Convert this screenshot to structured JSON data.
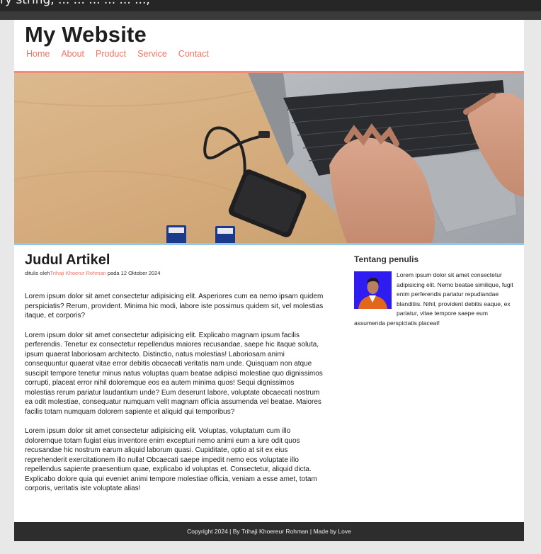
{
  "browser": {
    "top_text": "ry string, ... ... ... ... ... ...,"
  },
  "header": {
    "site_title": "My Website",
    "nav": [
      "Home",
      "About",
      "Product",
      "Service",
      "Contact"
    ]
  },
  "colors": {
    "accent": "#ef7565",
    "hero_border_top": "#f38a7c",
    "hero_border_bottom": "#8fc8ee",
    "footer_bg": "#2d2d2d"
  },
  "article": {
    "title": "Judul Artikel",
    "meta_prefix": "ditulis oleh",
    "author": "Trihaji Khoerur Rohman",
    "meta_suffix": " pada 12 Oktober 2024",
    "paragraphs": [
      "Lorem ipsum dolor sit amet consectetur adipisicing elit. Asperiores cum ea nemo ipsam quidem perspiciatis? Rerum, provident. Minima hic modi, labore iste possimus quidem sit, vel molestias itaque, et corporis?",
      "Lorem ipsum dolor sit amet consectetur adipisicing elit. Explicabo magnam ipsum facilis perferendis. Tenetur ex consectetur repellendus maiores recusandae, saepe hic itaque soluta, ipsum quaerat laboriosam architecto. Distinctio, natus molestias! Laboriosam animi consequuntur quaerat vitae error debitis obcaecati veritatis nam unde. Quisquam non atque suscipit tempore tenetur minus natus voluptas quam beatae adipisci molestiae quo dignissimos corrupti, placeat error nihil doloremque eos ea autem minima quos! Sequi dignissimos molestias rerum pariatur laudantium unde? Eum deserunt labore, voluptate obcaecati nostrum ea odit molestiae, consequatur numquam velit magnam officia assumenda vel beatae. Maiores facilis totam numquam dolorem sapiente et aliquid qui temporibus?",
      "Lorem ipsum dolor sit amet consectetur adipisicing elit. Voluptas, voluptatum cum illo doloremque totam fugiat eius inventore enim excepturi nemo animi eum a iure odit quos recusandae hic nostrum earum aliquid laborum quasi. Cupiditate, optio at sit ex eius reprehenderit exercitationem illo nulla! Obcaecati saepe impedit nemo eos voluptate illo repellendus sapiente praesentium quae, explicabo id voluptas et. Consectetur, aliquid dicta. Explicabo dolore quia qui eveniet animi tempore molestiae officia, veniam a esse amet, totam corporis, veritatis iste voluptate alias!"
    ]
  },
  "sidebar": {
    "title": "Tentang penulis",
    "bio": "Lorem ipsum dolor sit amet consectetur adipisicing elit. Nemo beatae similique, fugit enim perferendis pariatur repudiandae blanditiis. Nihil, provident debitis eaque, ex pariatur, vitae tempore saepe eum assumenda perspiciatis placeat!"
  },
  "footer": {
    "text": "Copyright 2024 | By Trihaji Khoereur Rohman | Made by Love"
  }
}
